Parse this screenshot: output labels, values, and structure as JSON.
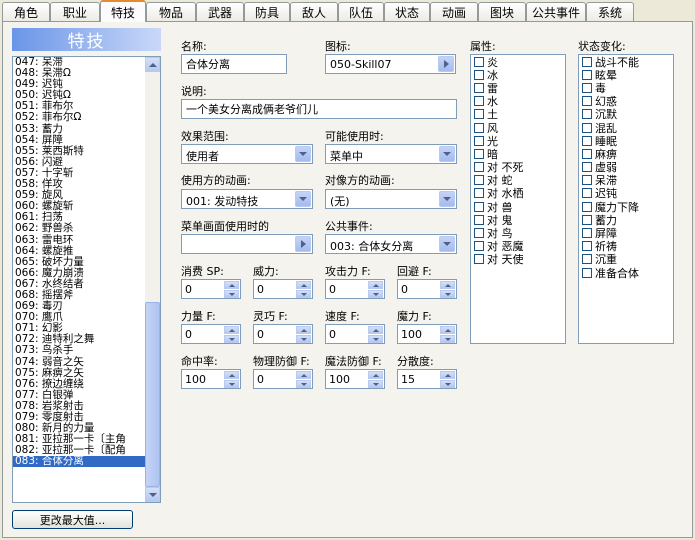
{
  "tabs": [
    "角色",
    "职业",
    "特技",
    "物品",
    "武器",
    "防具",
    "敌人",
    "队伍",
    "状态",
    "动画",
    "图块",
    "公共事件",
    "系统"
  ],
  "active_tab": "特技",
  "list_title": "特技",
  "skills": [
    "047: 呆滞",
    "048: 呆滞Ω",
    "049: 迟钝",
    "050: 迟钝Ω",
    "051: 菲布尔",
    "052: 菲布尔Ω",
    "053: 蓄力",
    "054: 屏障",
    "055: 莱西斯特",
    "056: 闪避",
    "057: 十字斩",
    "058: 佯攻",
    "059: 旋风",
    "060: 螺旋斩",
    "061: 扫荡",
    "062: 野兽杀",
    "063: 雷电环",
    "064: 螺旋推",
    "065: 破坏力量",
    "066: 魔力崩溃",
    "067: 水终结者",
    "068: 摇摆斧",
    "069: 毒刃",
    "070: 鹰爪",
    "071: 幻影",
    "072: 迪特利之舞",
    "073: 鸟杀手",
    "074: 弱音之矢",
    "075: 麻痹之矢",
    "076: 撩边缠绕",
    "077: 白银弹",
    "078: 岩浆射击",
    "079: 零度射击",
    "080: 新月的力量",
    "081: 亚拉那一卡〔主角",
    "082: 亚拉那一卡〔配角",
    "083: 合体分离"
  ],
  "selected_skill": "083: 合体分离",
  "max_button": "更改最大值...",
  "form": {
    "name_label": "名称:",
    "name_value": "合体分离",
    "icon_label": "图标:",
    "icon_value": "050-Skill07",
    "desc_label": "说明:",
    "desc_value": "一个美女分离成俩老爷们儿",
    "scope_label": "效果范围:",
    "scope_value": "使用者",
    "occasion_label": "可能使用时:",
    "occasion_value": "菜单中",
    "user_anim_label": "使用方的动画:",
    "user_anim_value": "001: 发动特技",
    "target_anim_label": "对像方的动画:",
    "target_anim_value": "(无)",
    "menu_se_label": "菜单画面使用时的",
    "menu_se_value": "",
    "common_event_label": "公共事件:",
    "common_event_value": "003: 合体女分离"
  },
  "stats": [
    {
      "label": "消费 SP:",
      "value": "0"
    },
    {
      "label": "威力:",
      "value": "0"
    },
    {
      "label": "攻击力 F:",
      "value": "0"
    },
    {
      "label": "回避 F:",
      "value": "0"
    },
    {
      "label": "力量 F:",
      "value": "0"
    },
    {
      "label": "灵巧 F:",
      "value": "0"
    },
    {
      "label": "速度 F:",
      "value": "0"
    },
    {
      "label": "魔力 F:",
      "value": "100"
    },
    {
      "label": "命中率:",
      "value": "100"
    },
    {
      "label": "物理防御 F:",
      "value": "0"
    },
    {
      "label": "魔法防御 F:",
      "value": "100"
    },
    {
      "label": "分散度:",
      "value": "15"
    }
  ],
  "attributes_label": "属性:",
  "attributes": [
    "炎",
    "冰",
    "雷",
    "水",
    "土",
    "风",
    "光",
    "暗",
    "对 不死",
    "对 蛇",
    "对 水栖",
    "对 兽",
    "对 鬼",
    "对 鸟",
    "对 恶魔",
    "对 天使"
  ],
  "states_label": "状态变化:",
  "states": [
    "战斗不能",
    "眩晕",
    "毒",
    "幻惑",
    "沉默",
    "混乱",
    "睡眠",
    "麻痹",
    "虚弱",
    "呆滞",
    "迟钝",
    "魔力下降",
    "蓄力",
    "屏障",
    "祈祷",
    "沉重",
    "准备合体"
  ]
}
